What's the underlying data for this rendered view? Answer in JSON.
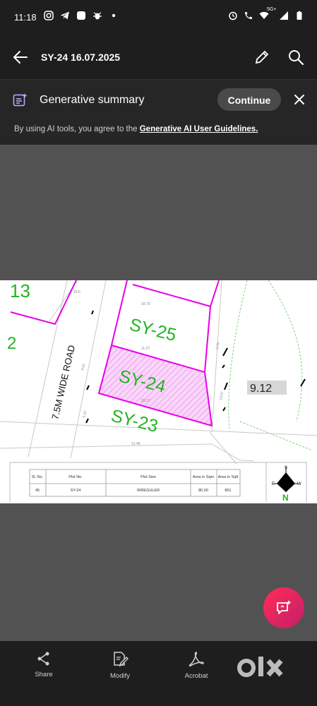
{
  "status_bar": {
    "time": "11:18",
    "network": "5G+",
    "icons_left": [
      "instagram-icon",
      "telegram-icon",
      "app-icon",
      "bug-icon",
      "dot-icon"
    ],
    "icons_right": [
      "alarm-icon",
      "wifi-call-icon",
      "wifi-icon",
      "signal-icon",
      "battery-icon"
    ]
  },
  "app_bar": {
    "title": "SY-24 16.07.2025",
    "icons": [
      "back-arrow-icon",
      "pencil-icon",
      "search-icon"
    ]
  },
  "gen_summary": {
    "title": "Generative summary",
    "continue_label": "Continue",
    "agree_prefix": "By using AI tools, you agree to the ",
    "agree_link": "Generative AI User Guidelines."
  },
  "document": {
    "plots": {
      "sy13": "13",
      "sy25": "SY-25",
      "sy24": "SY-24",
      "sy23": "SY-23",
      "frag": "2"
    },
    "road_label": "7.5M WIDE ROAD",
    "side_dim": "9.12",
    "table": {
      "headers": [
        "Sl. No.",
        "Plot No.",
        "Plot Size",
        "Area in Sqm",
        "Area in Sqft"
      ],
      "row": [
        "45",
        "SY-24",
        "IRREGULER",
        "80.00",
        "861"
      ]
    },
    "compass": {
      "n": "N",
      "s": "S",
      "e": "E",
      "w": "W"
    }
  },
  "bottom_nav": [
    {
      "label": "Share",
      "icon": "share-icon"
    },
    {
      "label": "Modify",
      "icon": "modify-icon"
    },
    {
      "label": "Acrobat",
      "icon": "acrobat-icon"
    }
  ],
  "watermark": "olx",
  "colors": {
    "bar_bg": "#1e1e1e",
    "canvas_bg": "#525252",
    "plot_border": "#e800e8",
    "plot_label": "#22b422",
    "fab": "#ff2d55"
  }
}
